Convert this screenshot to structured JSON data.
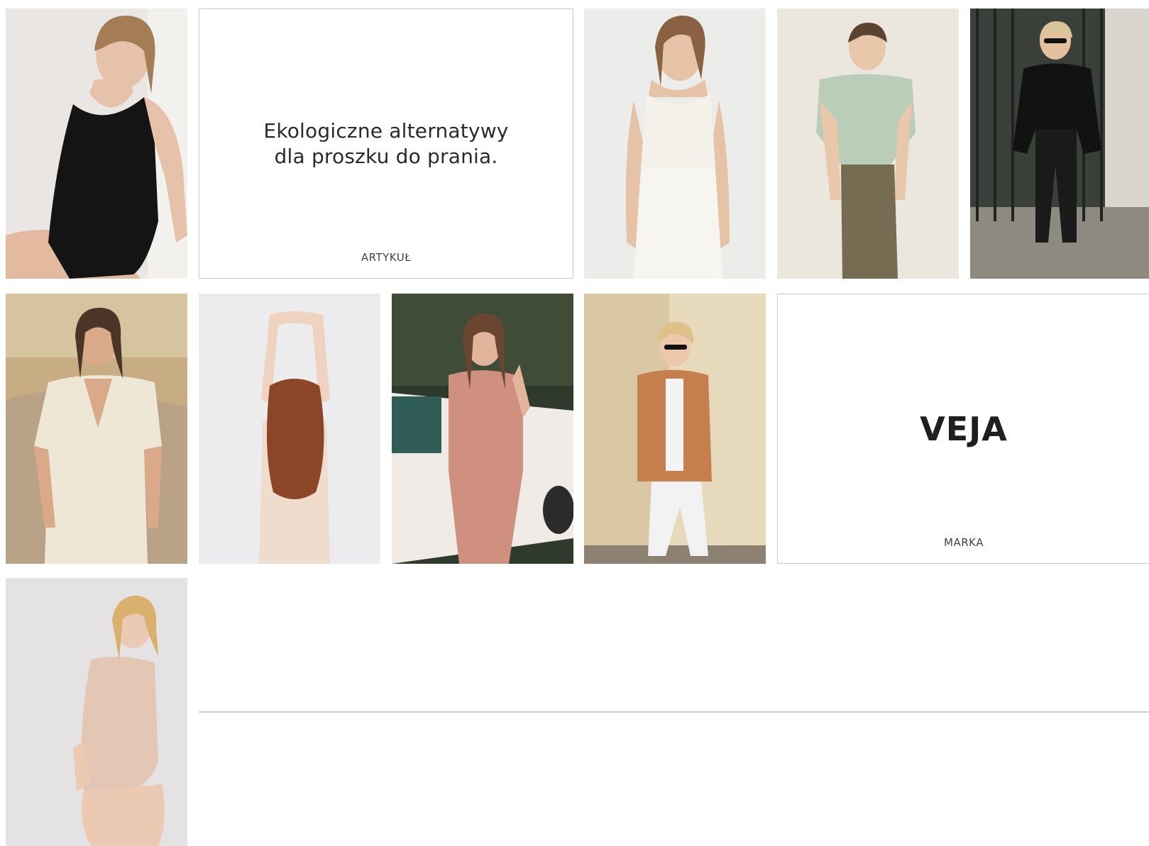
{
  "cards": {
    "article": {
      "title_line1": "Ekologiczne alternatywy",
      "title_line2": "dla proszku do prania.",
      "tag": "ARTYKUŁ"
    },
    "brand": {
      "title": "VEJA",
      "tag": "MARKA"
    }
  },
  "photos": [
    {
      "subject": "woman in black halter bodysuit",
      "colors": {
        "bg": "#e9e6e3",
        "garment": "#141414",
        "skin": "#e7c2aa",
        "hair": "#a47c56"
      }
    },
    {
      "subject": "woman in white camisole and trousers",
      "colors": {
        "bg": "#ececea",
        "garment": "#f4f1ea",
        "skin": "#e6c3a6",
        "hair": "#8a6142"
      }
    },
    {
      "subject": "woman in sage green tee and olive trousers",
      "colors": {
        "bg": "#ebe7de",
        "garment": "#b9cdb8",
        "pants": "#756c52",
        "skin": "#e9c7ab",
        "hair": "#5b4231"
      }
    },
    {
      "subject": "woman in black sweater walking by iron fence",
      "colors": {
        "bg": "#3a3f3a",
        "garment": "#121212",
        "skin": "#e4c09e",
        "hair": "#d8c49a",
        "street": "#8e8a82"
      }
    },
    {
      "subject": "woman in cream wrap dress on sand dune",
      "colors": {
        "bg": "#c8ad84",
        "garment": "#efe7d5",
        "skin": "#d9a98a",
        "hair": "#4b3526"
      }
    },
    {
      "subject": "woman from back with raised arms, long red hair",
      "colors": {
        "bg": "#ececee",
        "garment": "#efdccc",
        "skin": "#efd2bf",
        "hair": "#8a4626"
      }
    },
    {
      "subject": "woman in pink wrap dress by vintage car",
      "colors": {
        "bg": "#2f3a2c",
        "garment": "#d09080",
        "skin": "#e2b49b",
        "hair": "#6a4530",
        "car": "#f1ebe7"
      }
    },
    {
      "subject": "woman in tan blazer and white pants walking",
      "colors": {
        "bg": "#e6d9bc",
        "garment": "#c6804f",
        "pants": "#f2f2f2",
        "skin": "#ecc8ac",
        "hair": "#e0c08a"
      }
    },
    {
      "subject": "woman in nude bodysuit from behind",
      "colors": {
        "bg": "#e4e2e3",
        "garment": "#e3c6b3",
        "skin": "#ecc9b3",
        "hair": "#d9b06d"
      }
    }
  ]
}
